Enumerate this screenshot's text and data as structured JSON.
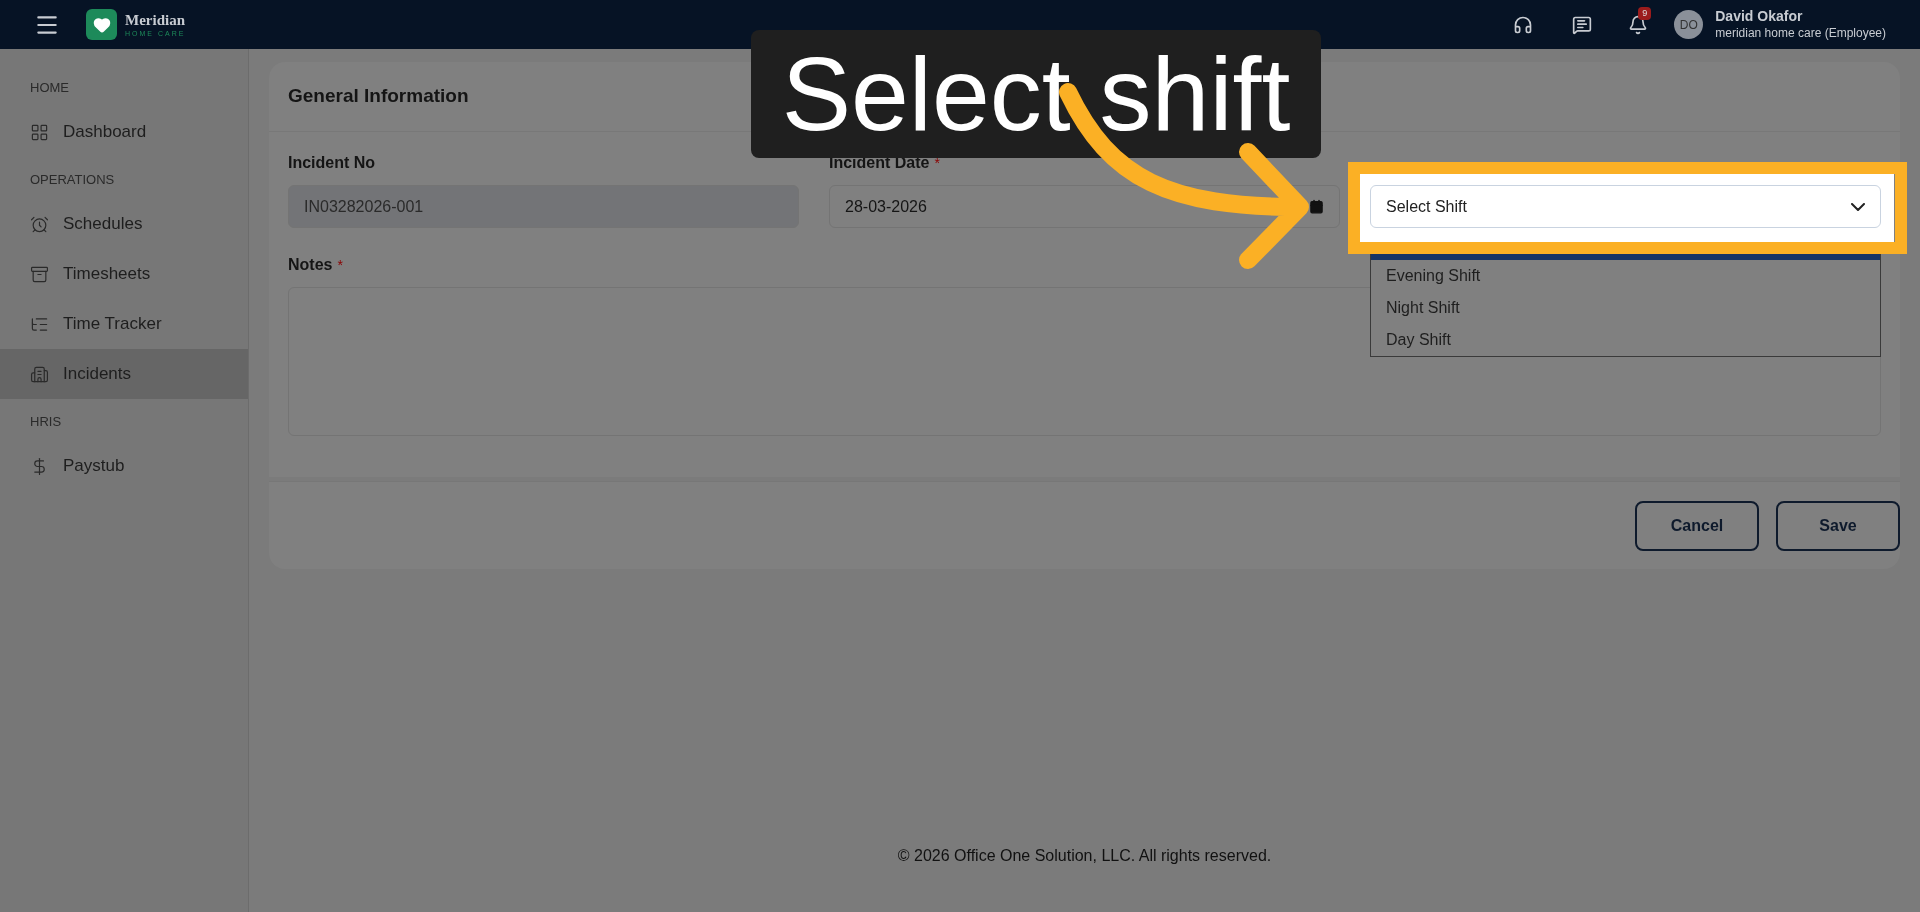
{
  "header": {
    "logo": {
      "name": "Meridian",
      "tagline": "HOME CARE"
    },
    "notifications_badge": "9",
    "user": {
      "initials": "DO",
      "name": "David Okafor",
      "role": "meridian home care (Employee)"
    }
  },
  "sidebar": {
    "sections": [
      {
        "title": "HOME",
        "items": [
          {
            "label": "Dashboard",
            "selected": false
          }
        ]
      },
      {
        "title": "OPERATIONS",
        "items": [
          {
            "label": "Schedules",
            "selected": false
          },
          {
            "label": "Timesheets",
            "selected": false
          },
          {
            "label": "Time Tracker",
            "selected": false
          },
          {
            "label": "Incidents",
            "selected": true
          }
        ]
      },
      {
        "title": "HRIS",
        "items": [
          {
            "label": "Paystub",
            "selected": false
          }
        ]
      }
    ]
  },
  "form": {
    "title": "General Information",
    "fields": [
      {
        "kind": "text",
        "label": "Incident No",
        "value": "IN03282026-001",
        "disabled": true
      },
      {
        "kind": "date",
        "label": "Incident Date",
        "mark": "*",
        "value": "28-03-2026",
        "disabled": false
      }
    ],
    "notes": {
      "label": "Notes",
      "mark": "*"
    },
    "shift_select": {
      "value": "Select Shift",
      "options": [
        {
          "selected": true
        },
        {
          "label": "Evening Shift",
          "selected": false
        },
        {
          "label": "Night Shift",
          "selected": false
        },
        {
          "label": "Day Shift",
          "selected": false
        }
      ]
    }
  },
  "buttons": [
    "Cancel",
    "Save"
  ],
  "footer": "© 2026 Office One Solution, LLC. All rights reserved.",
  "callout": {
    "text": "Select shift"
  }
}
